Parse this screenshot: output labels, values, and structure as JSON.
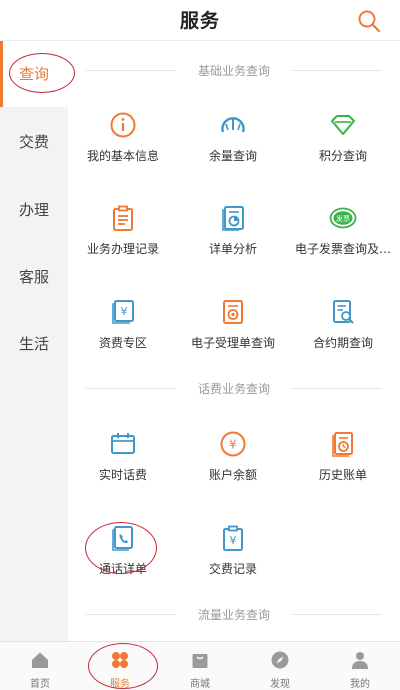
{
  "header": {
    "title": "服务"
  },
  "sidebar": {
    "items": [
      "查询",
      "交费",
      "办理",
      "客服",
      "生活"
    ]
  },
  "sections": [
    {
      "title": "基础业务查询",
      "items": [
        {
          "label": "我的基本信息",
          "icon": "info-circle-icon"
        },
        {
          "label": "余量查询",
          "icon": "gauge-icon"
        },
        {
          "label": "积分查询",
          "icon": "diamond-icon"
        },
        {
          "label": "业务办理记录",
          "icon": "clipboard-icon"
        },
        {
          "label": "详单分析",
          "icon": "chart-document-icon"
        },
        {
          "label": "电子发票查询及…",
          "icon": "invoice-badge-icon",
          "badge": "发票"
        },
        {
          "label": "资费专区",
          "icon": "yuan-document-icon"
        },
        {
          "label": "电子受理单查询",
          "icon": "receipt-icon"
        },
        {
          "label": "合约期查询",
          "icon": "search-document-icon"
        }
      ]
    },
    {
      "title": "话费业务查询",
      "items": [
        {
          "label": "实时话费",
          "icon": "calendar-icon"
        },
        {
          "label": "账户余额",
          "icon": "yuan-circle-icon"
        },
        {
          "label": "历史账单",
          "icon": "clock-document-icon"
        },
        {
          "label": "通话详单",
          "icon": "phone-document-icon"
        },
        {
          "label": "交费记录",
          "icon": "yuan-clipboard-icon"
        }
      ]
    },
    {
      "title": "流量业务查询",
      "items": []
    }
  ],
  "bottom_nav": {
    "items": [
      "首页",
      "服务",
      "商城",
      "发现",
      "我的"
    ]
  },
  "colors": {
    "accent": "#ef7a34",
    "blue": "#3f98c9",
    "green": "#3bb34a",
    "annotation": "#c8283a"
  }
}
